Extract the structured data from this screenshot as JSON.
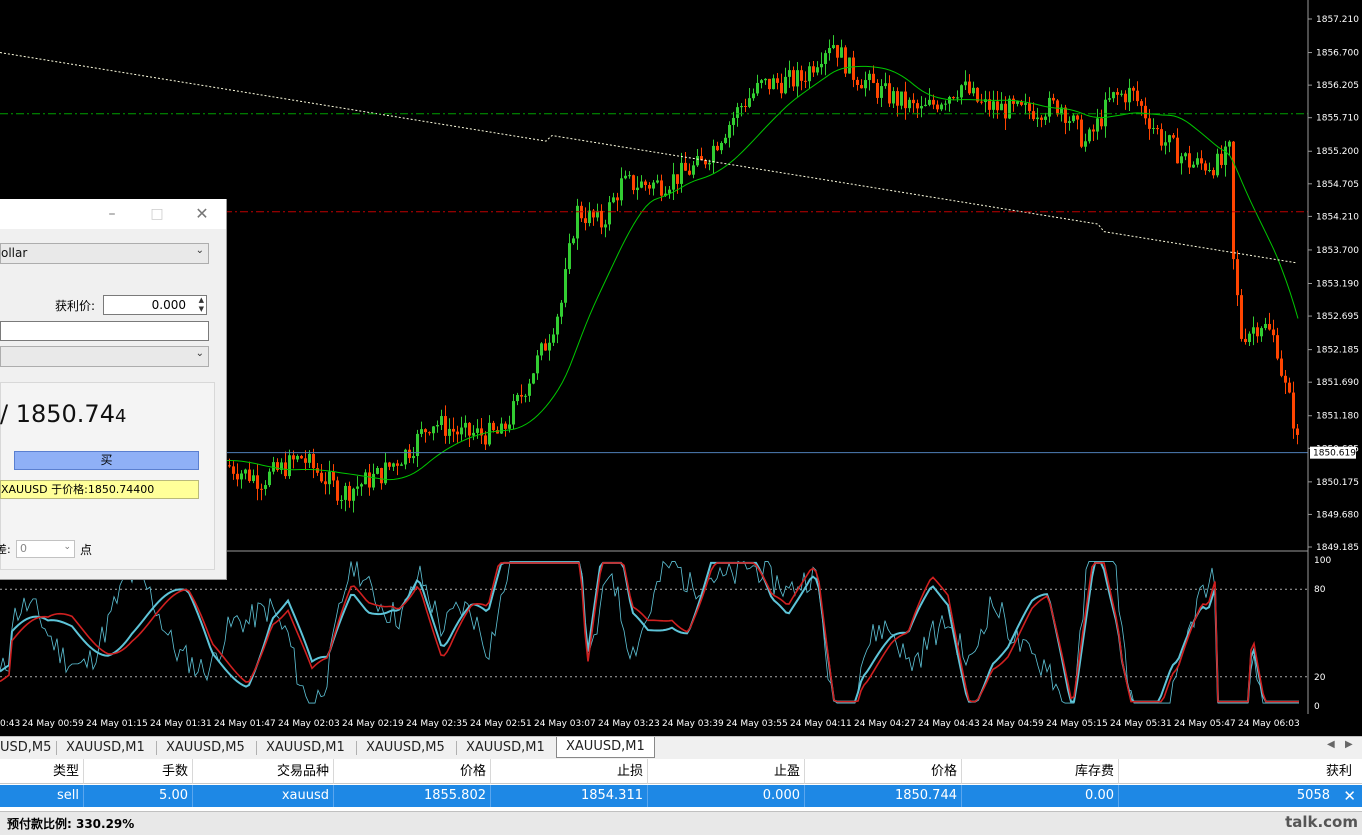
{
  "chart": {
    "price_axis": [
      "1857.210",
      "1856.700",
      "1856.205",
      "1855.710",
      "1855.200",
      "1854.705",
      "1854.210",
      "1853.700",
      "1853.190",
      "1852.695",
      "1852.185",
      "1851.690",
      "1851.180",
      "1850.685",
      "1850.175",
      "1849.680",
      "1849.185"
    ],
    "price_range": [
      1849.185,
      1857.21
    ],
    "current_price": "1850.619",
    "bid_line": 1850.619,
    "tp_line": 1855.77,
    "sl_line": 1854.28,
    "osc_levels": [
      "100",
      "80",
      "20",
      "0"
    ],
    "time_labels": [
      "0:43",
      "24 May 00:59",
      "24 May 01:15",
      "24 May 01:31",
      "24 May 01:47",
      "24 May 02:03",
      "24 May 02:19",
      "24 May 02:35",
      "24 May 02:51",
      "24 May 03:07",
      "24 May 03:23",
      "24 May 03:39",
      "24 May 03:55",
      "24 May 04:11",
      "24 May 04:27",
      "24 May 04:43",
      "24 May 04:59",
      "24 May 05:15",
      "24 May 05:31",
      "24 May 05:47",
      "24 May 06:03"
    ],
    "colors": {
      "bull": "#32cd32",
      "bear": "#ff4500",
      "ma_fast": "#00c800",
      "ma_slow": "#ffffe0",
      "tp": "#00a000",
      "sl": "#c00000",
      "bid": "#4f7fb8",
      "stoch_main": "#5ec4d8",
      "stoch_signal": "#d02020"
    }
  },
  "dialog": {
    "symbol_value": "ollar",
    "tp_label": "获利价:",
    "tp_value": "0.000",
    "price_display": "/ 1850.744",
    "price_main": "/ 1850.74",
    "price_small": "4",
    "buy_label": "买",
    "status_text": "XAUUSD 于价格:1850.74400",
    "deviation_label": "差:",
    "deviation_value": "0",
    "deviation_unit": "点"
  },
  "tabs": [
    "USD,M5",
    "XAUUSD,M1",
    "XAUUSD,M5",
    "XAUUSD,M1",
    "XAUUSD,M5",
    "XAUUSD,M1",
    "XAUUSD,M1"
  ],
  "active_tab": 6,
  "table": {
    "headers": [
      "类型",
      "手数",
      "交易品种",
      "价格",
      "止损",
      "止盈",
      "价格",
      "库存费",
      "获利"
    ],
    "row": [
      "sell",
      "5.00",
      "xauusd",
      "1855.802",
      "1854.311",
      "0.000",
      "1850.744",
      "0.00",
      "5058"
    ]
  },
  "status": {
    "margin_level": "预付款比例: 330.29%",
    "watermark": "talk.com"
  }
}
